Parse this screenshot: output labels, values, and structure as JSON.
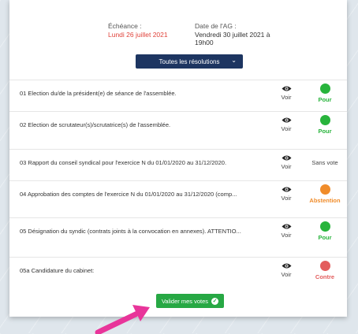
{
  "header": {
    "deadline_label": "Échéance :",
    "deadline_value": "Lundi 26 juillet 2021",
    "ag_date_label": "Date de l'AG :",
    "ag_date_line1": "Vendredi 30 juillet 2021 à",
    "ag_date_line2": "19h00"
  },
  "filter": {
    "selected": "Toutes les résolutions",
    "icon": "chevron-down-icon"
  },
  "view_label": "Voir",
  "resolutions": [
    {
      "title": "01 Election du/de la président(e) de séance de l'assemblée.",
      "vote": "Pour",
      "color": "#28b43c"
    },
    {
      "title": "02 Election de scrutateur(s)/scrutatrice(s) de l'assemblée.",
      "vote": "Pour",
      "color": "#28b43c"
    },
    {
      "title": "03 Rapport du conseil syndical pour l'exercice N du 01/01/2020 au 31/12/2020.",
      "vote": "Sans vote",
      "color": ""
    },
    {
      "title": "04 Approbation des comptes de l'exercice N du 01/01/2020 au 31/12/2020 (comp...",
      "vote": "Abstention",
      "color": "#f08c2a"
    },
    {
      "title": "05 Désignation du syndic (contrats joints à la convocation en annexes). ATTENTIO...",
      "vote": "Pour",
      "color": "#28b43c"
    },
    {
      "title": "05a Candidature du cabinet:",
      "vote": "Contre",
      "color": "#e35d5d"
    }
  ],
  "submit": {
    "label": "Valider mes votes",
    "icon": "check-circle-icon"
  },
  "colors": {
    "navy": "#1d3561",
    "green": "#27a844",
    "red": "#e0433b",
    "arrow": "#e8359a"
  }
}
